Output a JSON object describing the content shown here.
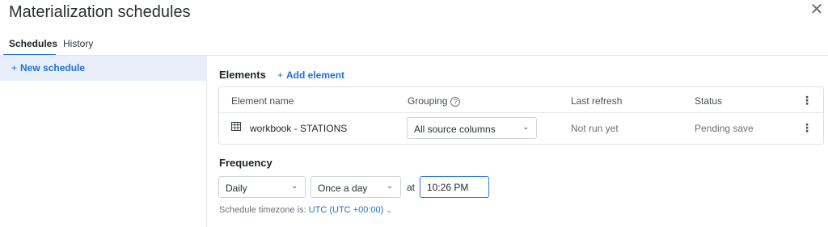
{
  "dialog": {
    "title": "Materialization schedules",
    "close_glyph": "✕"
  },
  "tabs": [
    {
      "label": "Schedules",
      "active": true
    },
    {
      "label": "History",
      "active": false
    }
  ],
  "sidebar": {
    "new_schedule_label": "New schedule",
    "plus": "+"
  },
  "elements": {
    "title": "Elements",
    "add_label": "Add element",
    "columns": {
      "name": "Element name",
      "grouping": "Grouping",
      "last_refresh": "Last refresh",
      "status": "Status"
    },
    "rows": [
      {
        "icon": "table-icon",
        "name": "workbook - STATIONS",
        "grouping": "All source columns",
        "last_refresh": "Not run yet",
        "status": "Pending save"
      }
    ]
  },
  "frequency": {
    "title": "Frequency",
    "period": "Daily",
    "interval": "Once a day",
    "at_label": "at",
    "time": "10:26 PM",
    "timezone_prefix": "Schedule timezone is:",
    "timezone_value": "UTC (UTC +00:00)"
  },
  "colors": {
    "accent": "#1f6fd6",
    "selected_bg": "#e8effa"
  }
}
